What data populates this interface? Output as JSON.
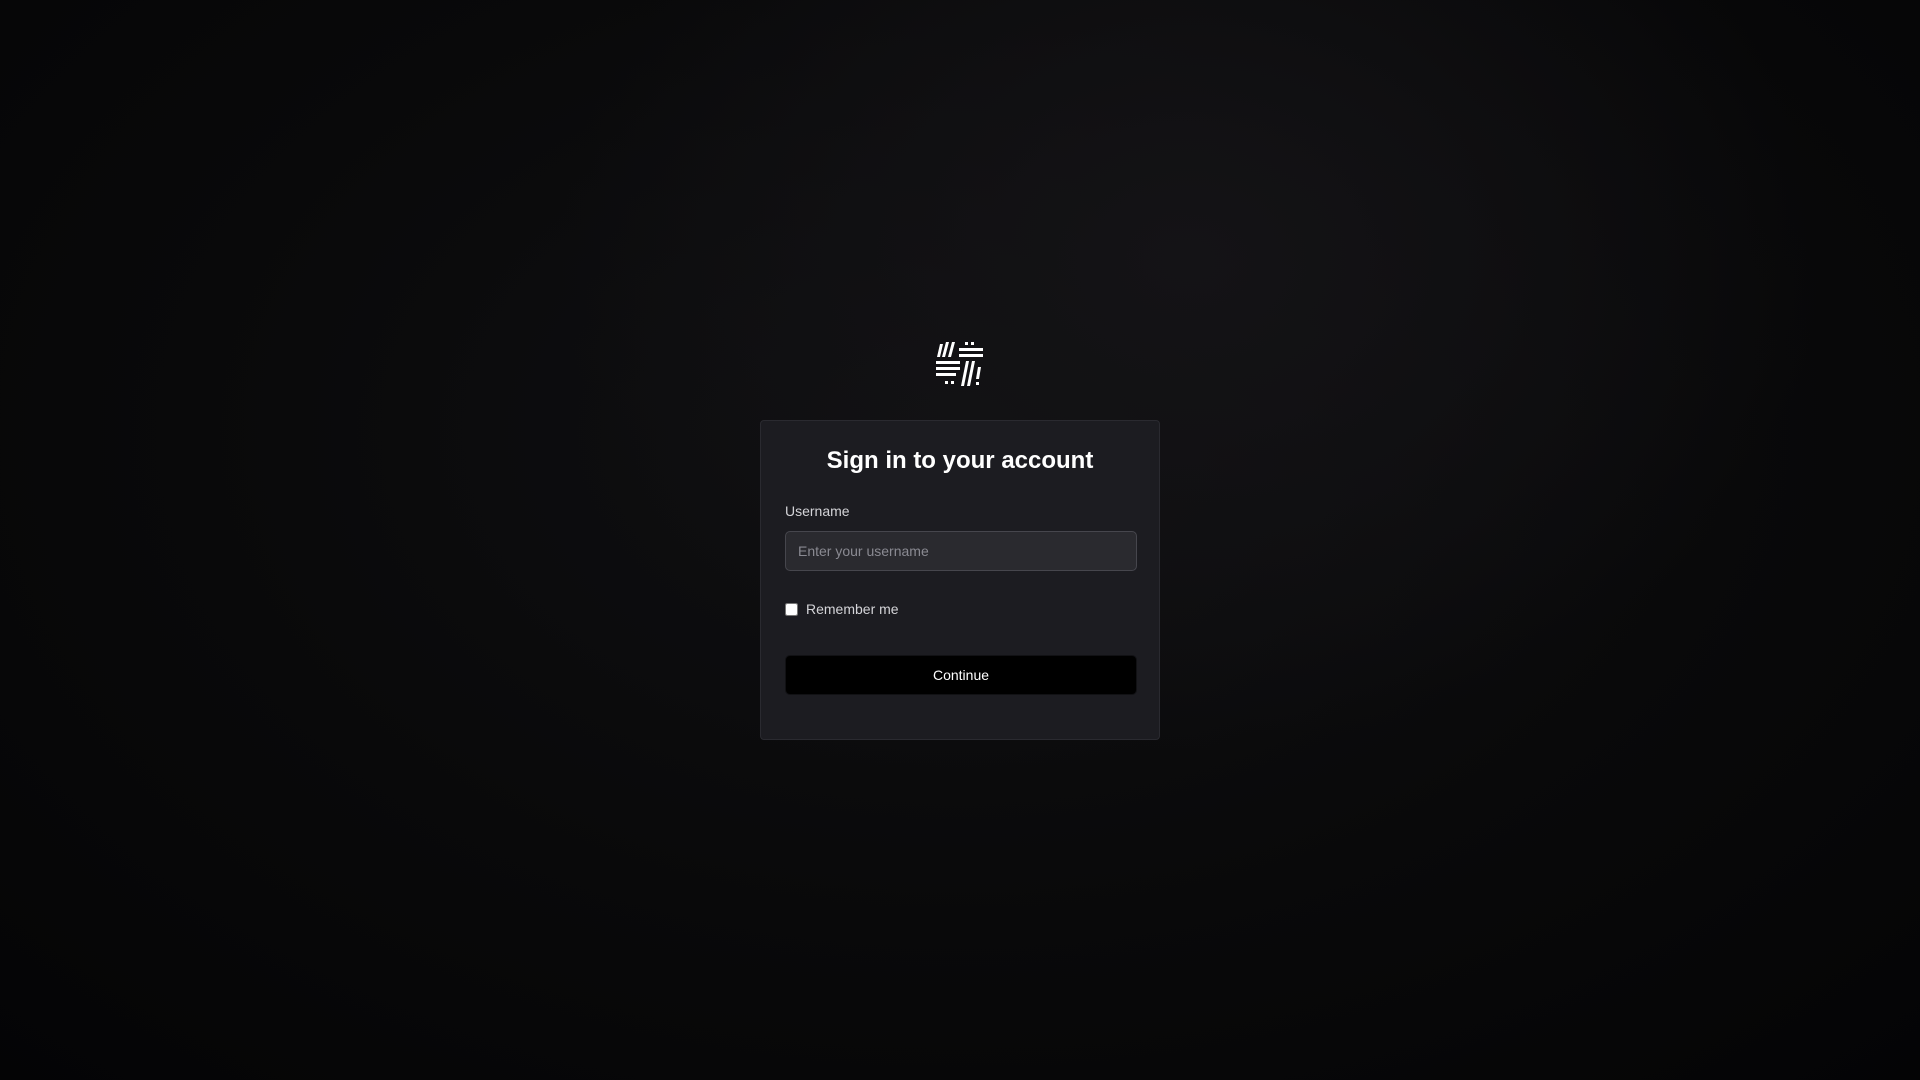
{
  "brand": {
    "logo_icon": "hash-slash-logo-icon",
    "logo_color": "#ffffff"
  },
  "login": {
    "title": "Sign in to your account",
    "username_label": "Username",
    "username_value": "",
    "username_placeholder": "Enter your username",
    "remember_label": "Remember me",
    "remember_checked": false,
    "continue_label": "Continue"
  },
  "colors": {
    "background": "#0b0b0c",
    "card_background": "#1c1c21",
    "input_background": "#2a2a2f",
    "button_background": "#000000",
    "text_primary": "#ffffff",
    "text_secondary": "#d4d4d8",
    "placeholder": "#8a8a92"
  }
}
